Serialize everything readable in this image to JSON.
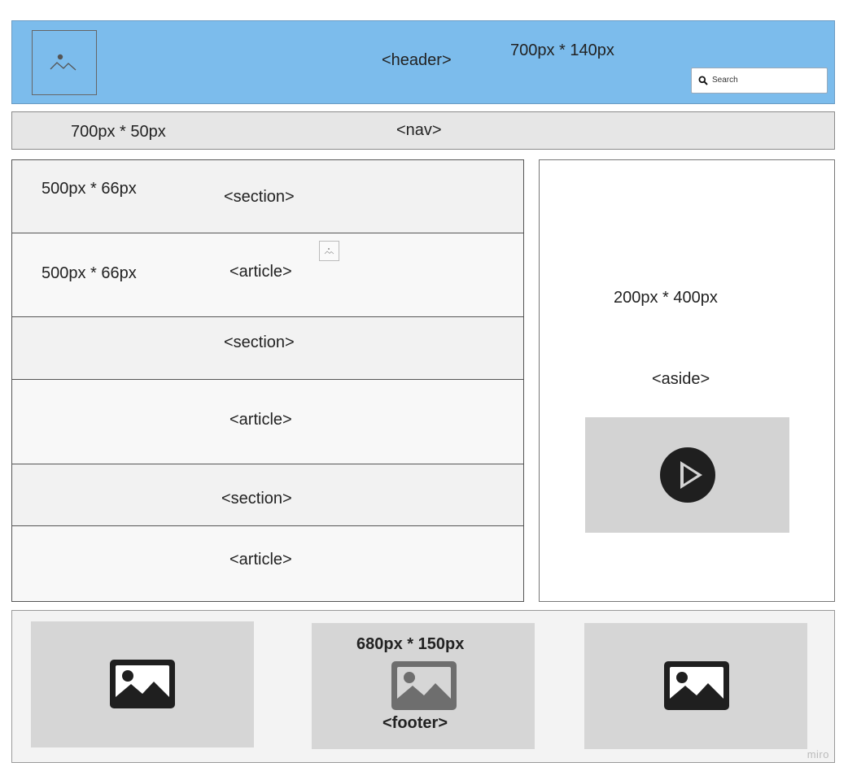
{
  "header": {
    "tag_label": "<header>",
    "size_label": "700px * 140px",
    "search_placeholder": "Search",
    "logo_icon": "image-placeholder-icon",
    "search_icon": "search-icon",
    "background_color": "#7cbcec"
  },
  "nav": {
    "size_label": "700px * 50px",
    "tag_label": "<nav>"
  },
  "main": {
    "rows": [
      {
        "tag_label": "<section>",
        "size_label": "500px * 66px"
      },
      {
        "tag_label": "<article>",
        "size_label": "500px * 66px"
      },
      {
        "tag_label": "<section>",
        "size_label": ""
      },
      {
        "tag_label": "<article>",
        "size_label": ""
      },
      {
        "tag_label": "<section>",
        "size_label": ""
      },
      {
        "tag_label": "<article>",
        "size_label": ""
      }
    ]
  },
  "aside": {
    "size_label": "200px * 400px",
    "tag_label": "<aside>",
    "video_icon": "play-icon"
  },
  "footer": {
    "size_label": "680px * 150px",
    "tag_label": "<footer>",
    "image_icon": "image-icon"
  },
  "watermark": "miro"
}
